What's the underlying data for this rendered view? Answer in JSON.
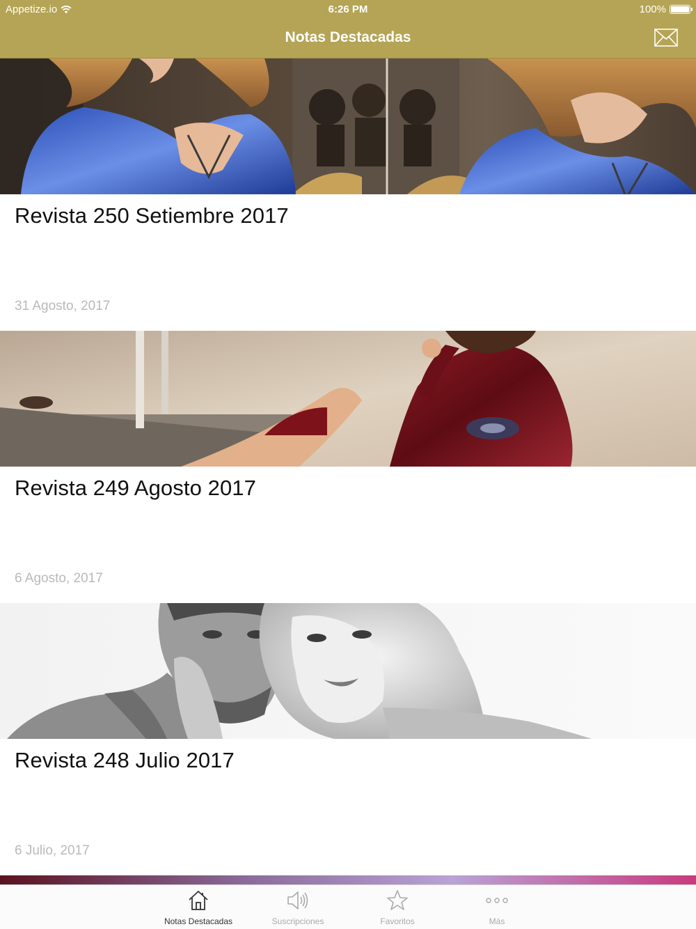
{
  "status_bar": {
    "carrier": "Appetize.io",
    "time": "6:26 PM",
    "battery": "100%"
  },
  "nav": {
    "title": "Notas Destacadas",
    "right_icon": "mail-icon"
  },
  "articles": [
    {
      "title": "Revista 250 Setiembre 2017",
      "date": "31 Agosto, 2017"
    },
    {
      "title": "Revista 249 Agosto 2017",
      "date": "6 Agosto, 2017"
    },
    {
      "title": "Revista 248 Julio 2017",
      "date": "6 Julio, 2017"
    }
  ],
  "tabbar": {
    "tabs": [
      {
        "label": "Notas Destacadas",
        "icon": "home-icon",
        "active": true
      },
      {
        "label": "Suscripciones",
        "icon": "speaker-icon",
        "active": false
      },
      {
        "label": "Favoritos",
        "icon": "star-icon",
        "active": false
      },
      {
        "label": "Más",
        "icon": "more-icon",
        "active": false
      }
    ]
  },
  "colors": {
    "nav_background": "#b5a455",
    "title_text": "#111111",
    "date_text": "#b9b9b9",
    "tab_inactive": "#a9a9a9",
    "tab_active": "#333333"
  }
}
